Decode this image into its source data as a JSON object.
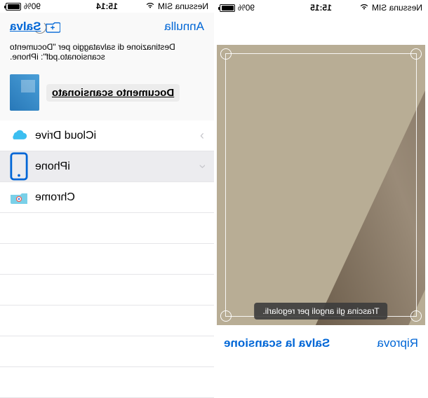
{
  "left": {
    "status": {
      "carrier": "Nessuna SIM",
      "time": "15:15",
      "battery": "90%"
    },
    "hint": "Trascina gli angoli per regolarli.",
    "retry": "Riprova",
    "save_scan": "Salva la scansione"
  },
  "right": {
    "status": {
      "carrier": "Nessuna SIM",
      "time": "15:14",
      "battery": "90%"
    },
    "cancel": "Annulla",
    "save": "Salva",
    "description": "Destinazione di salvataggio per \"Documento scansionato.pdf\": iPhone.",
    "doc_name": "Documento scansionato",
    "locations": [
      {
        "label": "iCloud Drive",
        "icon": "icloud"
      },
      {
        "label": "iPhone",
        "icon": "iphone"
      },
      {
        "label": "Chrome",
        "icon": "chrome"
      }
    ]
  }
}
